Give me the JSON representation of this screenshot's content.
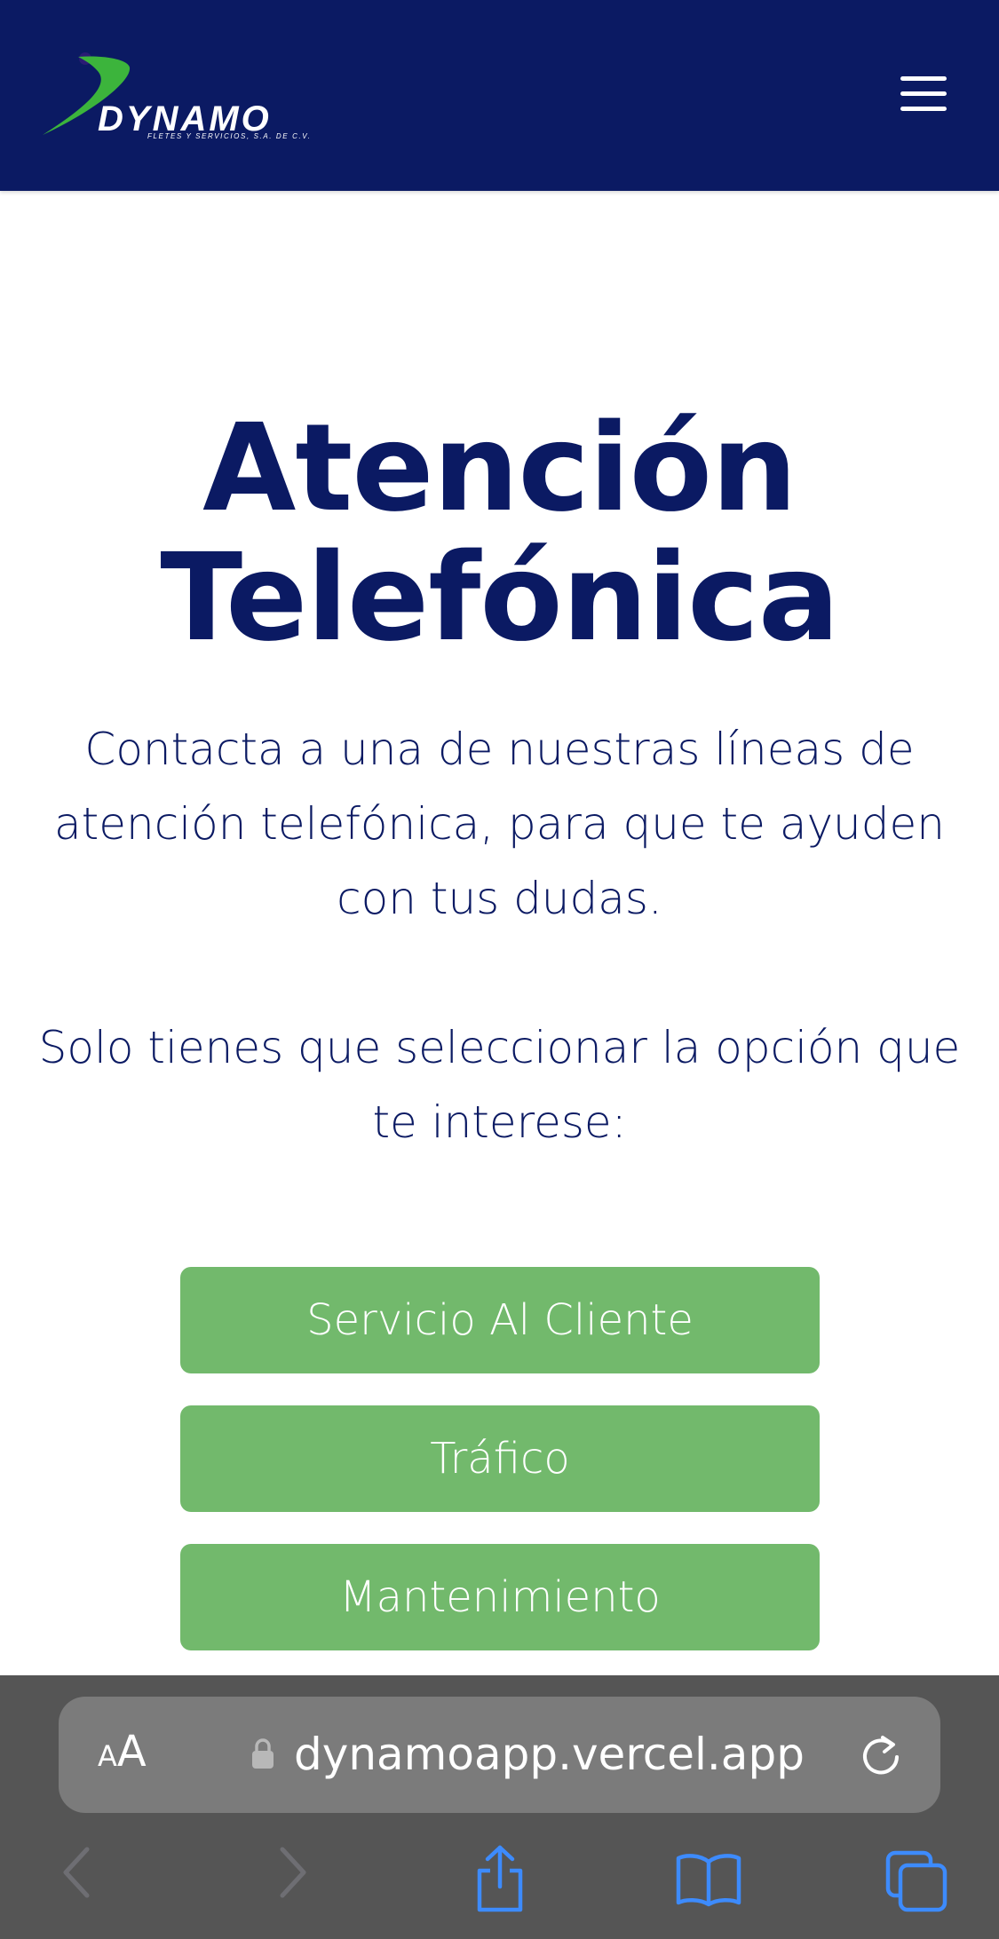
{
  "header": {
    "logo_word": "DYNAMO",
    "logo_sub": "FLETES Y SERVICIOS, S.A. DE C.V.",
    "menu_icon": "hamburger-icon",
    "background": "#0b1a63",
    "logo_accent": "#3cb43c"
  },
  "main": {
    "title_line1": "Atención",
    "title_line2": "Telefónica",
    "description": "Contacta a una de nuestras líneas de atención telefónica, para que te ayuden con tus dudas.",
    "instruction": "Solo tienes que seleccionar la opción que te interese:",
    "text_color": "#0b1a63",
    "buttons": [
      {
        "label": "Servicio Al Cliente"
      },
      {
        "label": "Tráfico"
      },
      {
        "label": "Mantenimiento"
      }
    ],
    "button_color": "#72b96c"
  },
  "browser": {
    "text_size_small": "A",
    "text_size_big": "A",
    "url": "dynamoapp.vercel.app",
    "icons": {
      "lock": "lock-icon",
      "reload": "reload-icon",
      "back": "back-icon",
      "forward": "forward-icon",
      "share": "share-icon",
      "bookmarks": "bookmarks-icon",
      "tabs": "tabs-icon"
    },
    "toolbar_active_color": "#3d8bfd",
    "toolbar_disabled_color": "#6e6e73"
  }
}
